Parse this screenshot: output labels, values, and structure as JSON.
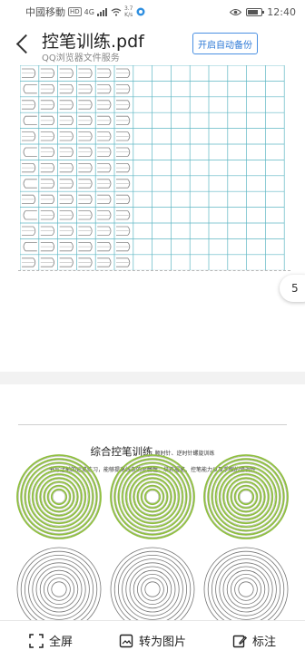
{
  "status_bar": {
    "carrier": "中國移動",
    "network_badge": "HD",
    "signal": "4G",
    "speed_value": "3.7",
    "speed_unit": "K/s",
    "time": "12:40"
  },
  "header": {
    "title": "控笔训练.pdf",
    "subtitle": "QQ浏览器文件服务",
    "backup_button": "开启自动备份"
  },
  "document": {
    "page_badge": "5",
    "exercise_heading": "综合控笔训练",
    "exercise_heading_note": "顺时针、逆时针螺旋训练",
    "exercise_description": "书写之前的运笔练习，能够提高线条的流畅性，培养握笔、控笔能力以及手眼的协调性",
    "grid_color": "#5fb7c4",
    "spiral_color": "#8fbf3f"
  },
  "toolbar": {
    "fullscreen": "全屏",
    "to_image": "转为图片",
    "annotate": "标注"
  }
}
